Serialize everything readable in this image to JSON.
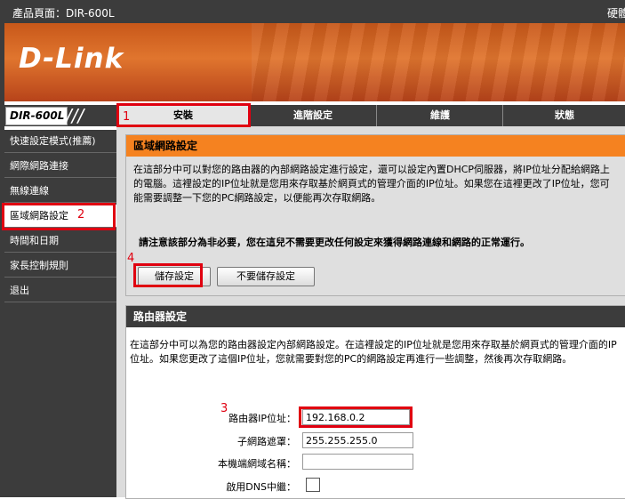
{
  "topbar": {
    "product": "產品頁面：DIR-600L",
    "hardware": "硬體"
  },
  "brand": {
    "logo": "D-Link",
    "model": "DIR-600L",
    "slashes": "///"
  },
  "tabs": [
    "安裝",
    "進階設定",
    "維護",
    "狀態"
  ],
  "sidebar": [
    "快速設定模式(推薦)",
    "網際網路連接",
    "無線連線",
    "區域網路設定",
    "時間和日期",
    "家長控制規則",
    "退出"
  ],
  "lan": {
    "header": "區域網路設定",
    "desc": "在這部分中可以對您的路由器的內部網路設定進行設定，還可以設定內置DHCP伺服器，將IP位址分配給網路上的電腦。這裡設定的IP位址就是您用來存取基於網頁式的管理介面的IP位址。如果您在這裡更改了IP位址，您可能需要調整一下您的PC網路設定，以便能再次存取網路。",
    "warning": "請注意該部分為非必要，您在這兒不需要更改任何設定來獲得網路連線和網路的正常運行。",
    "save": "儲存設定",
    "nosave": "不要儲存設定"
  },
  "router": {
    "header": "路由器設定",
    "desc": "在這部分中可以為您的路由器設定內部網路設定。在這裡設定的IP位址就是您用來存取基於網頁式的管理介面的IP位址。如果您更改了這個IP位址，您就需要對您的PC的網路設定再進行一些調整，然後再次存取網路。",
    "ip_label": "路由器IP位址：",
    "ip_value": "192.168.0.2",
    "mask_label": "子網路遮罩：",
    "mask_value": "255.255.255.0",
    "domain_label": "本機端網域名稱：",
    "domain_value": "",
    "dns_label": "啟用DNS中繼："
  },
  "annotations": [
    "1",
    "2",
    "3",
    "4"
  ],
  "colors": {
    "orange_header": "#f58220",
    "dark": "#3c3c3c",
    "highlight": "#e00010"
  }
}
